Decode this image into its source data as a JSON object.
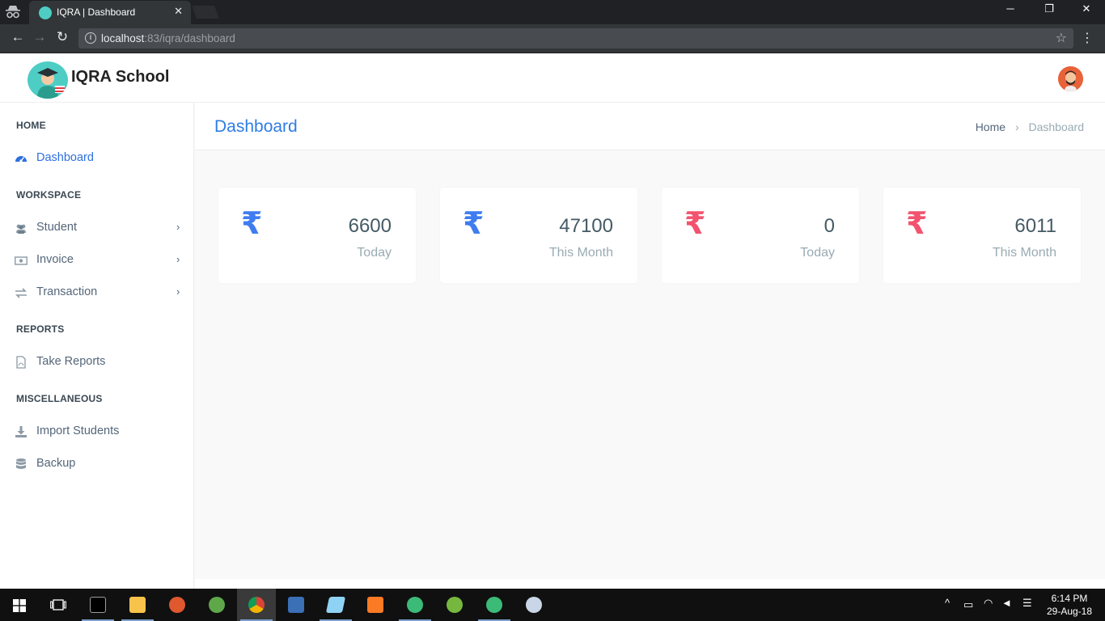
{
  "browser": {
    "tab_title": "IQRA | Dashboard",
    "tab_close": "✕",
    "url_host": "localhost",
    "url_rest": ":83/iqra/dashboard",
    "win_minimize": "─",
    "win_restore": "❐",
    "win_close": "✕",
    "back": "←",
    "forward": "→",
    "reload": "↻",
    "star": "☆",
    "menu": "⋮"
  },
  "header": {
    "brand": "IQRA School"
  },
  "sidebar": {
    "sections": [
      {
        "label": "HOME"
      },
      {
        "label": "WORKSPACE"
      },
      {
        "label": "REPORTS"
      },
      {
        "label": "MISCELLANEOUS"
      }
    ],
    "items": [
      {
        "label": "Dashboard",
        "icon": "dashboard-icon",
        "active": true
      },
      {
        "label": "Student",
        "icon": "users-icon",
        "has_children": true
      },
      {
        "label": "Invoice",
        "icon": "money-icon",
        "has_children": true
      },
      {
        "label": "Transaction",
        "icon": "exchange-icon",
        "has_children": true
      },
      {
        "label": "Take Reports",
        "icon": "pdf-file-icon"
      },
      {
        "label": "Import Students",
        "icon": "download-icon"
      },
      {
        "label": "Backup",
        "icon": "database-icon"
      }
    ],
    "chevron": "›"
  },
  "page": {
    "title": "Dashboard",
    "breadcrumb_home": "Home",
    "breadcrumb_sep": "›",
    "breadcrumb_current": "Dashboard"
  },
  "cards": [
    {
      "symbol": "₹",
      "value": "6600",
      "caption": "Today",
      "color": "#3f7cf0"
    },
    {
      "symbol": "₹",
      "value": "47100",
      "caption": "This Month",
      "color": "#3f7cf0"
    },
    {
      "symbol": "₹",
      "value": "0",
      "caption": "Today",
      "color": "#f2536e"
    },
    {
      "symbol": "₹",
      "value": "6011",
      "caption": "This Month",
      "color": "#f2536e"
    }
  ],
  "taskbar": {
    "time": "6:14 PM",
    "date": "29-Aug-18"
  },
  "colors": {
    "accent": "#2e7de6",
    "sidebar_text": "#54667a",
    "positive": "#3f7cf0",
    "negative": "#f2536e"
  }
}
